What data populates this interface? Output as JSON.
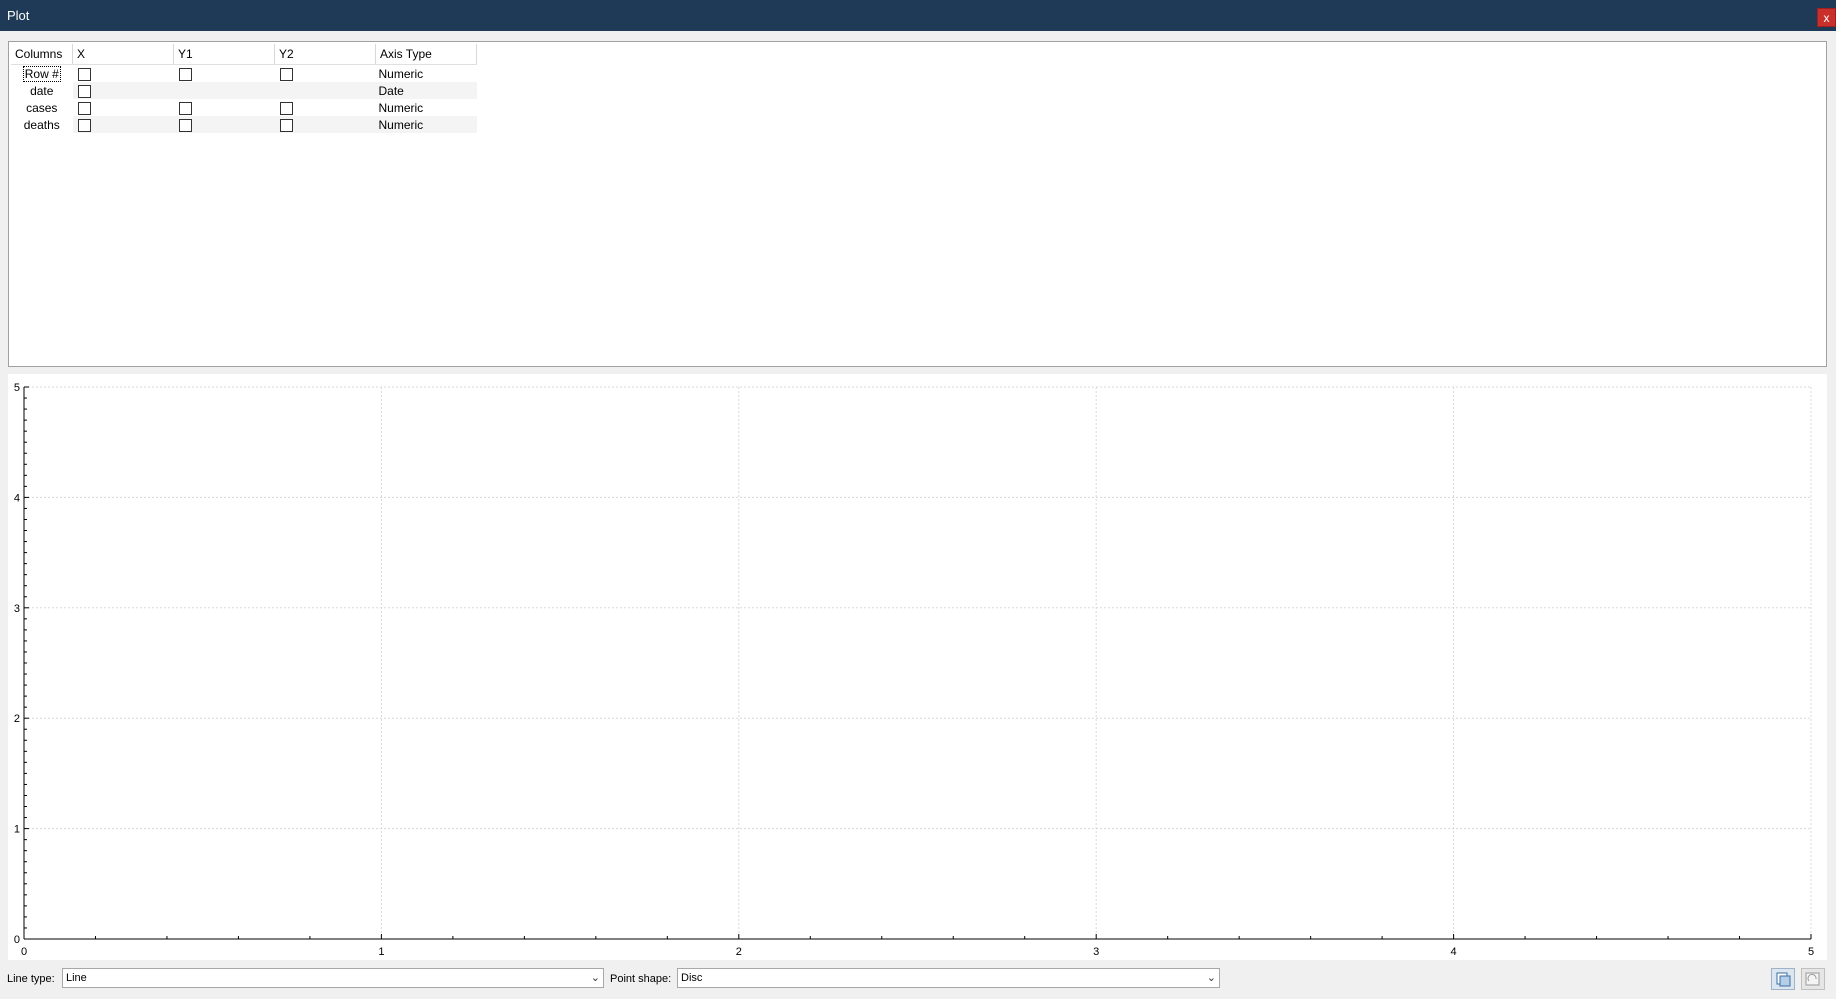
{
  "window": {
    "title": "Plot",
    "close_label": "x"
  },
  "columns_table": {
    "headers": [
      "Columns",
      "X",
      "Y1",
      "Y2",
      "Axis Type"
    ],
    "rows": [
      {
        "name": "Row #",
        "x": false,
        "y1": false,
        "y2": false,
        "axis_type": "Numeric",
        "has_y": true
      },
      {
        "name": "date",
        "x": false,
        "y1": null,
        "y2": null,
        "axis_type": "Date",
        "has_y": false
      },
      {
        "name": "cases",
        "x": false,
        "y1": false,
        "y2": false,
        "axis_type": "Numeric",
        "has_y": true
      },
      {
        "name": "deaths",
        "x": false,
        "y1": false,
        "y2": false,
        "axis_type": "Numeric",
        "has_y": true
      }
    ]
  },
  "chart_data": {
    "type": "line",
    "series": [],
    "xlim": [
      0,
      5
    ],
    "ylim": [
      0,
      5
    ],
    "x_ticks": [
      "0",
      "1",
      "2",
      "3",
      "4",
      "5"
    ],
    "y_ticks": [
      "0",
      "1",
      "2",
      "3",
      "4",
      "5"
    ],
    "grid": true
  },
  "controls": {
    "line_type_label": "Line type:",
    "line_type_value": "Line",
    "point_shape_label": "Point shape:",
    "point_shape_value": "Disc"
  },
  "icons": {
    "copy": "copy-plot-icon",
    "refresh": "refresh-plot-icon"
  }
}
